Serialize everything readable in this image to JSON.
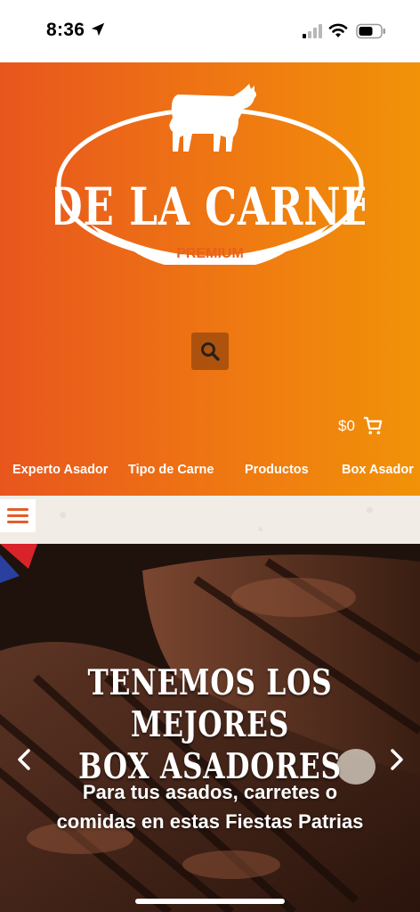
{
  "status_bar": {
    "time": "8:36",
    "icons": [
      "location-arrow-icon",
      "cellular-signal-icon",
      "wifi-icon",
      "battery-icon"
    ]
  },
  "header": {
    "logo": {
      "brand_name": "DE LA CARNE",
      "tagline": "PREMIUM"
    },
    "search_icon": "magnifier-icon",
    "cart_total": "$0",
    "cart_icon": "shopping-cart-icon",
    "nav_items": [
      "Experto Asador",
      "Tipo de Carne",
      "Productos",
      "Box Asador"
    ]
  },
  "menu": {
    "icon": "hamburger-menu-icon"
  },
  "hero": {
    "title_line1": "TENEMOS LOS MEJORES",
    "title_line2": "BOX ASADORES",
    "subtitle_line1": "Para tus asados, carretes o",
    "subtitle_line2": "comidas en estas Fiestas Patrias",
    "prev_icon": "chevron-left-icon",
    "next_icon": "chevron-right-icon"
  },
  "colors": {
    "header_gradient_start": "#e8561e",
    "header_gradient_end": "#f19208",
    "menu_icon": "#e25d2c",
    "menu_strip": "#f1ede6"
  }
}
